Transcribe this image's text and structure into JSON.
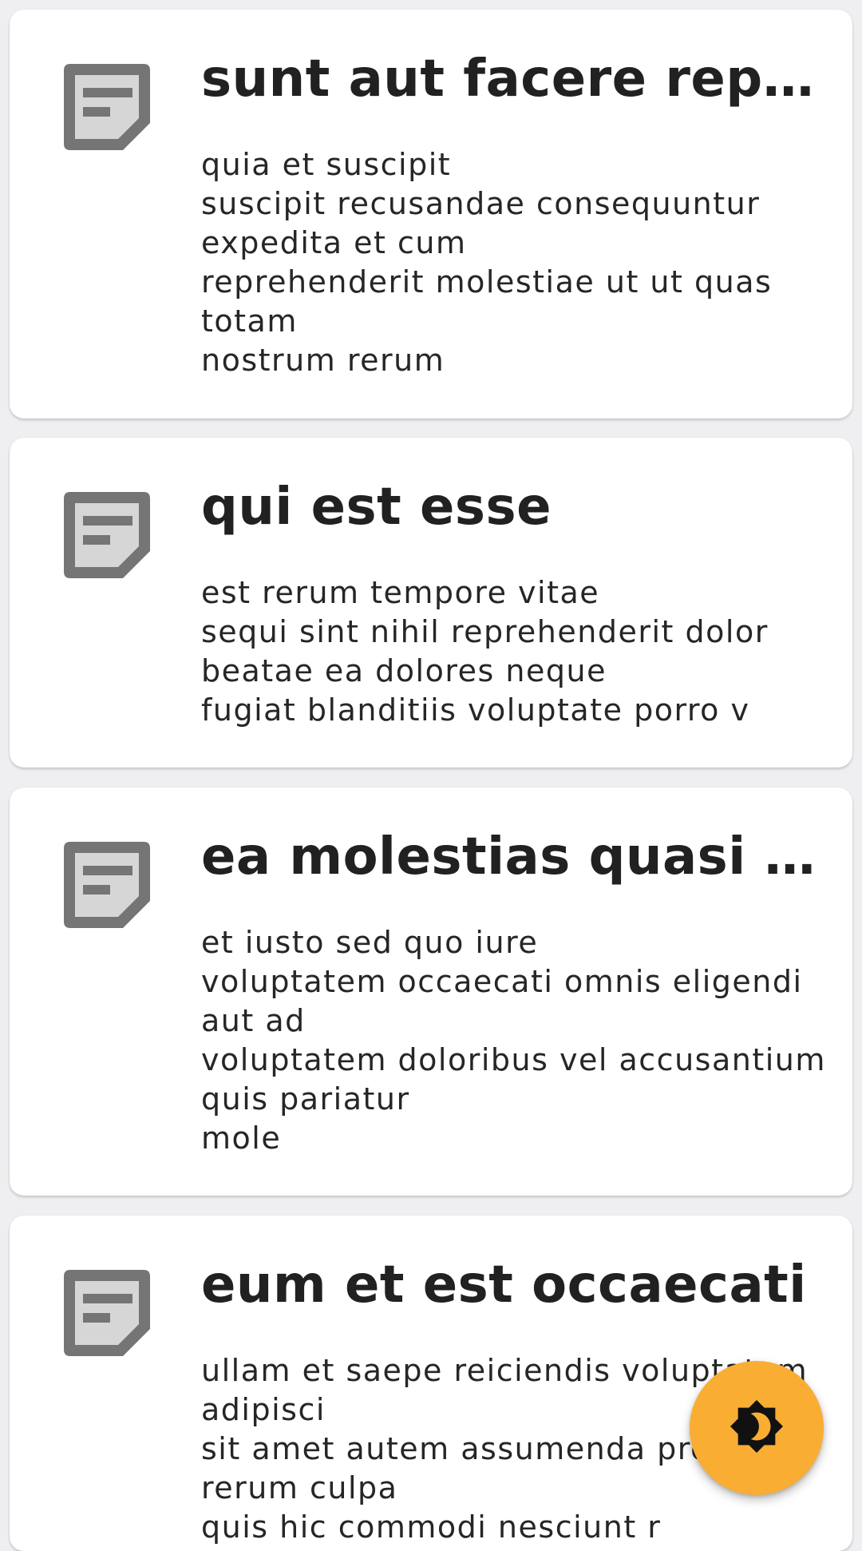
{
  "posts": [
    {
      "title": "sunt aut facere rep...",
      "body": "quia et suscipit\nsuscipit recusandae consequuntur expedita et cum\nreprehenderit molestiae ut ut quas totam\nnostrum rerum",
      "icon": "note-icon"
    },
    {
      "title": "qui est esse",
      "body": "est rerum tempore vitae\nsequi sint nihil reprehenderit dolor beatae ea dolores neque\nfugiat blanditiis voluptate porro v",
      "icon": "note-icon"
    },
    {
      "title": "ea molestias quasi ...",
      "body": "et iusto sed quo iure\nvoluptatem occaecati omnis eligendi aut ad\nvoluptatem doloribus vel accusantium quis pariatur\nmole",
      "icon": "note-icon"
    },
    {
      "title": "eum et est occaecati",
      "body": "ullam et saepe reiciendis voluptatem adipisci\nsit amet autem assumenda provident rerum culpa\nquis hic commodi nesciunt r",
      "icon": "note-icon"
    }
  ],
  "fab": {
    "icon": "theme-toggle-icon"
  },
  "colors": {
    "background": "#efeff1",
    "card": "#ffffff",
    "icon": "#757575",
    "icon_fill": "#d6d6d6",
    "fab": "#f9ad33",
    "text": "#212121"
  }
}
